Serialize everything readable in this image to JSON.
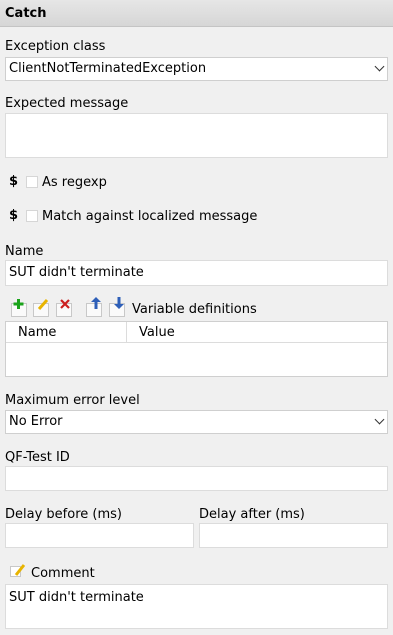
{
  "panel": {
    "title": "Catch"
  },
  "exception_class": {
    "label": "Exception class",
    "value": "ClientNotTerminatedException"
  },
  "expected_message": {
    "label": "Expected message",
    "value": ""
  },
  "as_regexp": {
    "prefix": "$",
    "label": "As regexp",
    "checked": false
  },
  "match_localized": {
    "prefix": "$",
    "label": "Match against localized message",
    "checked": false
  },
  "name": {
    "label": "Name",
    "value": "SUT didn't terminate"
  },
  "variables": {
    "label": "Variable definitions",
    "columns": [
      "Name",
      "Value"
    ],
    "rows": [],
    "toolbar": [
      "add-icon",
      "edit-icon",
      "delete-icon",
      "move-up-icon",
      "move-down-icon"
    ]
  },
  "max_error_level": {
    "label": "Maximum error level",
    "value": "No Error"
  },
  "qftest_id": {
    "label": "QF-Test ID",
    "value": ""
  },
  "delay_before": {
    "label": "Delay before (ms)",
    "value": ""
  },
  "delay_after": {
    "label": "Delay after (ms)",
    "value": ""
  },
  "comment": {
    "label": "Comment",
    "value": "SUT didn't terminate"
  },
  "colors": {
    "add": "#1aa31a",
    "edit": "#e8b400",
    "delete": "#cc1f1f",
    "arrows": "#2e5fb8"
  }
}
